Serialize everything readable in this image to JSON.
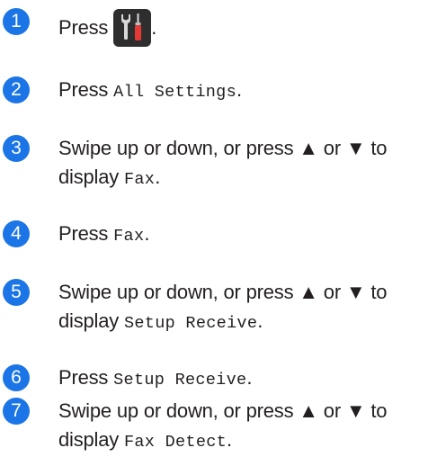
{
  "steps": [
    {
      "number": "1",
      "before": "Press",
      "icon": "settings-tools-icon",
      "after": "."
    },
    {
      "number": "2",
      "before": "Press ",
      "code": "All Settings",
      "after": "."
    },
    {
      "number": "3",
      "line1": "Swipe up or down, or press ▲ or ▼ to",
      "before": "display ",
      "code": "Fax",
      "after": "."
    },
    {
      "number": "4",
      "before": "Press ",
      "code": "Fax",
      "after": "."
    },
    {
      "number": "5",
      "line1": "Swipe up or down, or press ▲ or ▼ to",
      "before": "display ",
      "code": "Setup Receive",
      "after": "."
    },
    {
      "number": "6",
      "before": "Press ",
      "code": "Setup Receive",
      "after": "."
    },
    {
      "number": "7",
      "line1": "Swipe up or down, or press ▲ or ▼ to",
      "before": "display ",
      "code": "Fax Detect",
      "after": "."
    }
  ],
  "colors": {
    "badge": "#1b75e6",
    "text": "#231f20",
    "icon_button_bg": "#2e2e2e",
    "wrench": "#d9d9d9",
    "screwdriver_handle": "#e53935"
  }
}
